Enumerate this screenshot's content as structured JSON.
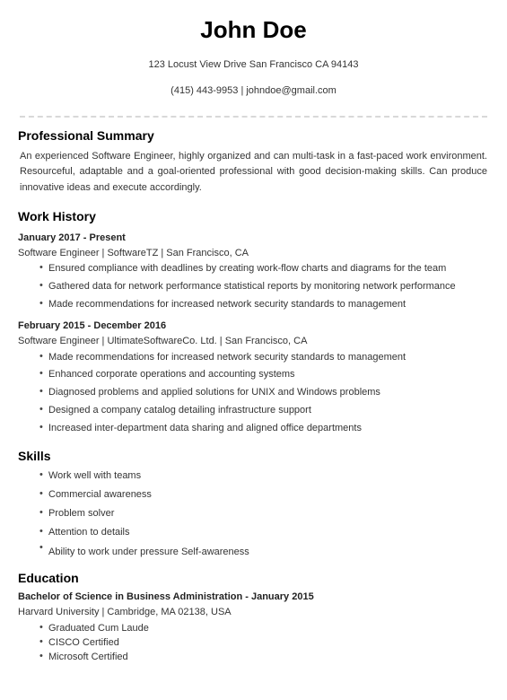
{
  "header": {
    "name": "John Doe",
    "address": "123 Locust View Drive San Francisco CA 94143",
    "contact": "(415) 443-9953 | johndoe@gmail.com"
  },
  "summary": {
    "title": "Professional Summary",
    "text": "An experienced Software Engineer, highly organized and can multi-task in a fast-paced work environment. Resourceful, adaptable and a goal-oriented professional with good decision-making skills. Can produce innovative ideas and execute accordingly."
  },
  "work_history": {
    "title": "Work History",
    "entries": [
      {
        "date": "January 2017 - Present",
        "subtitle": "Software Engineer | SoftwareTZ | San Francisco, CA",
        "bullets": [
          "Ensured compliance with deadlines by creating work-flow charts and diagrams for the team",
          "Gathered data for network performance statistical reports by monitoring network performance",
          "Made recommendations for increased network security standards to management"
        ]
      },
      {
        "date": "February 2015 - December 2016",
        "subtitle": "Software Engineer | UltimateSoftwareCo. Ltd. | San Francisco, CA",
        "bullets": [
          "Made recommendations for increased network security standards to management",
          "Enhanced corporate operations and accounting systems",
          "Diagnosed problems and applied solutions for UNIX and Windows problems",
          "Designed a company catalog detailing infrastructure support",
          "Increased inter-department data sharing and aligned office departments"
        ]
      }
    ]
  },
  "skills": {
    "title": "Skills",
    "items": [
      "Work well with teams",
      "Commercial awareness",
      "Problem solver",
      "Attention to details"
    ],
    "last_item": "Ability to work under pressure Self-awareness"
  },
  "education": {
    "title": "Education",
    "degree": "Bachelor of Science in Business Administration - January 2015",
    "school": "Harvard University | Cambridge, MA 02138, USA",
    "bullets": [
      "Graduated Cum Laude",
      "CISCO Certified",
      "Microsoft Certified"
    ]
  },
  "colors": {
    "text": "#333333",
    "heading": "#000000",
    "divider": "#d8d8d8"
  }
}
